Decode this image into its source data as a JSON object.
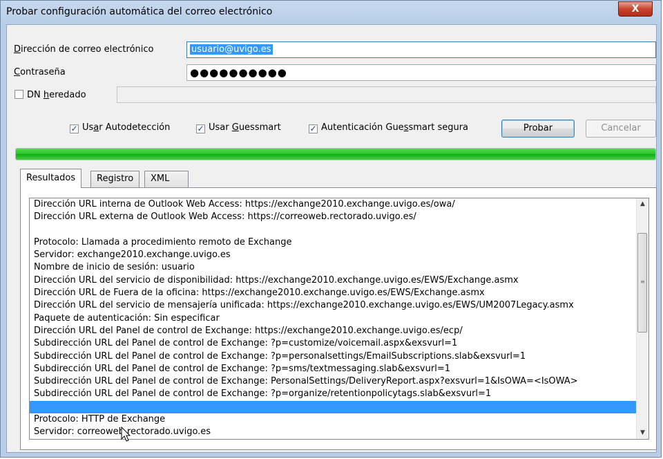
{
  "window": {
    "title": "Probar configuración automática del correo electrónico",
    "close_glyph": "X"
  },
  "form": {
    "email_label_u": "D",
    "email_label_rest": "irección de correo electrónico",
    "email_value": "usuario@uvigo.es",
    "password_label_u": "C",
    "password_label_rest": "ontraseña",
    "password_value": "●●●●●●●●●●",
    "dn_label_pre": "DN ",
    "dn_label_u": "h",
    "dn_label_rest": "eredado",
    "dn_checked": false,
    "dn_value": ""
  },
  "options": {
    "autodetect_pre": "Us",
    "autodetect_u": "a",
    "autodetect_rest": "r Autodetección",
    "guessmart_pre": "Usar ",
    "guessmart_u": "G",
    "guessmart_rest": "uessmart",
    "secure_pre": "Autenticación Gue",
    "secure_u": "s",
    "secure_rest": "smart segura",
    "checked": true,
    "test_button": "Probar",
    "cancel_button": "Cancelar"
  },
  "progress_percent": 100,
  "tabs": [
    {
      "label": "Resultados"
    },
    {
      "label": "Registro"
    },
    {
      "label": "XML"
    }
  ],
  "results": [
    "Dirección URL interna de Outlook Web Access: https://exchange2010.exchange.uvigo.es/owa/",
    "Dirección URL externa de Outlook Web Access: https://correoweb.rectorado.uvigo.es/",
    "",
    "Protocolo: Llamada a procedimiento remoto de Exchange",
    "Servidor: exchange2010.exchange.uvigo.es",
    "Nombre de inicio de sesión: usuario",
    "Dirección URL del servicio de disponibilidad: https://exchange2010.exchange.uvigo.es/EWS/Exchange.asmx",
    "Dirección URL de Fuera de la oficina: https://exchange2010.exchange.uvigo.es/EWS/Exchange.asmx",
    "Dirección URL del servicio de mensajería unificada: https://exchange2010.exchange.uvigo.es/EWS/UM2007Legacy.asmx",
    "Paquete de autenticación: Sin especificar",
    "Dirección URL del Panel de control de Exchange: https://exchange2010.exchange.uvigo.es/ecp/",
    "Subdirección URL del Panel de control de Exchange: ?p=customize/voicemail.aspx&exsvurl=1",
    "Subdirección URL del Panel de control de Exchange: ?p=personalsettings/EmailSubscriptions.slab&exsvurl=1",
    "Subdirección URL del Panel de control de Exchange: ?p=sms/textmessaging.slab&exsvurl=1",
    "Subdirección URL del Panel de control de Exchange: PersonalSettings/DeliveryReport.aspx?exsvurl=1&IsOWA=<IsOWA>",
    "Subdirección URL del Panel de control de Exchange: ?p=organize/retentionpolicytags.slab&exsvurl=1",
    "",
    "Protocolo: HTTP de Exchange",
    "Servidor: correoweb.rectorado.uvigo.es"
  ],
  "selected_result_index": 16,
  "scrollbar": {
    "up_glyph": "▲",
    "down_glyph": "▼",
    "grip_glyph": "≡"
  }
}
